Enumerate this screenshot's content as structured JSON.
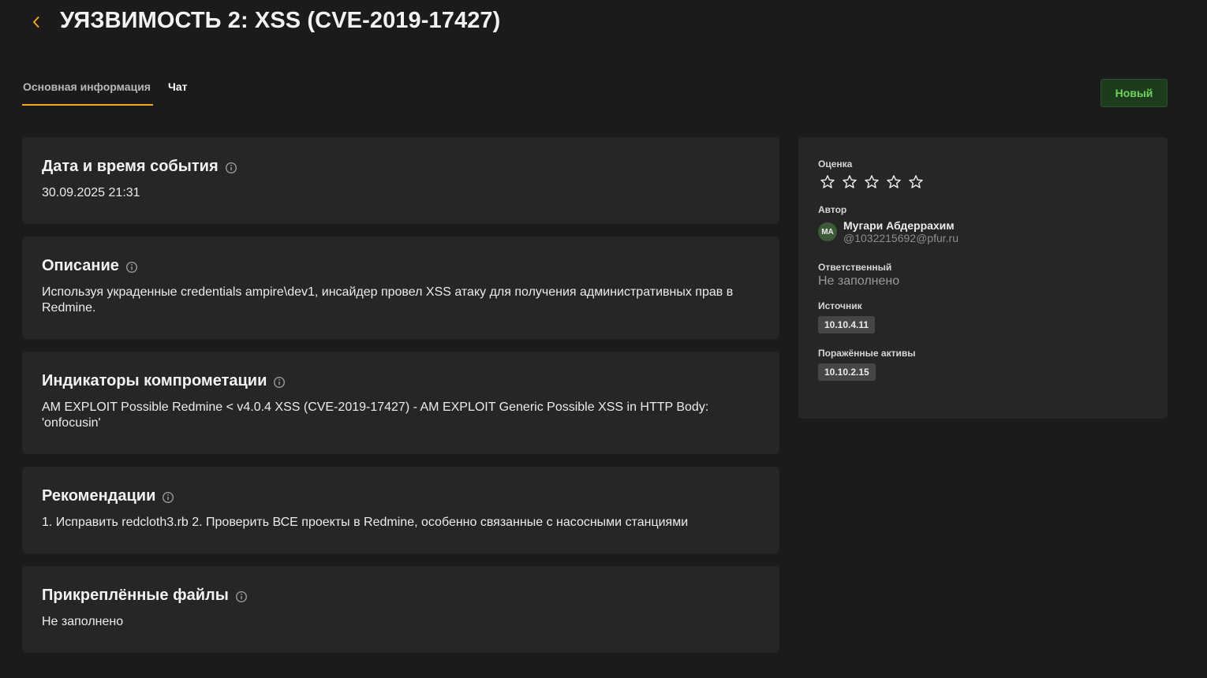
{
  "header": {
    "back_icon": "chevron-left-icon",
    "title": "УЯЗВИМОСТЬ 2: XSS (CVE-2019-17427)"
  },
  "tabs": [
    {
      "label": "Основная информация",
      "active": true
    },
    {
      "label": "Чат",
      "active": false
    }
  ],
  "status": {
    "label": "Новый",
    "color": "#6fd35e"
  },
  "accent_color": "#f5a623",
  "sections": {
    "event_time": {
      "title": "Дата и время события",
      "value": "30.09.2025 21:31"
    },
    "description": {
      "title": "Описание",
      "value": "Используя украденные credentials ampire\\dev1, инсайдер провел XSS атаку для получения административных прав в Redmine."
    },
    "ioc": {
      "title": "Индикаторы компрометации",
      "value": "AM EXPLOIT Possible Redmine < v4.0.4 XSS (CVE-2019-17427) - AM EXPLOIT Generic Possible XSS in HTTP Body: 'onfocusin'"
    },
    "recommendations": {
      "title": "Рекомендации",
      "value": "1. Исправить redcloth3.rb 2. Проверить ВСЕ проекты в Redmine, особенно связанные с насосными станциями"
    },
    "attachments": {
      "title": "Прикреплённые файлы",
      "value": "Не заполнено"
    }
  },
  "sidebar": {
    "rating": {
      "label": "Оценка",
      "value": 0,
      "max": 5
    },
    "author": {
      "label": "Автор",
      "initials": "МА",
      "name": "Мугари Абдеррахим",
      "email": "@1032215692@pfur.ru"
    },
    "assignee": {
      "label": "Ответственный",
      "value": "Не заполнено"
    },
    "source": {
      "label": "Источник",
      "value": "10.10.4.11"
    },
    "affected_assets": {
      "label": "Поражённые активы",
      "value": "10.10.2.15"
    }
  }
}
